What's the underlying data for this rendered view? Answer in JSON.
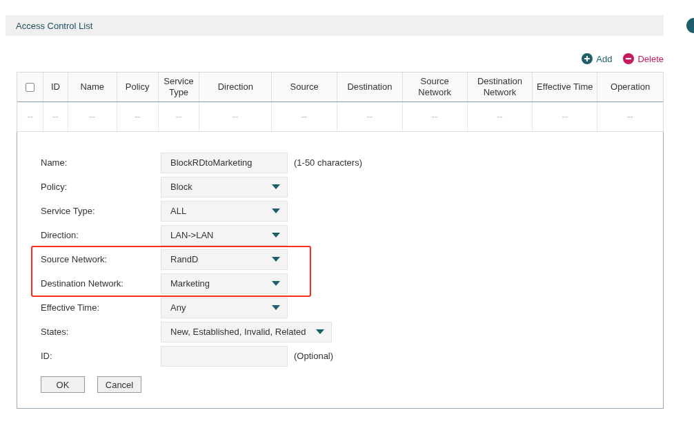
{
  "panel_title": "Access Control List",
  "toolbar": {
    "add": "Add",
    "delete": "Delete"
  },
  "table": {
    "columns": [
      {
        "kind": "checkbox",
        "checked": false
      },
      {
        "kind": "text",
        "label": "ID"
      },
      {
        "kind": "text",
        "label": "Name"
      },
      {
        "kind": "text",
        "label": "Policy"
      },
      {
        "kind": "text",
        "label": "Service Type"
      },
      {
        "kind": "text",
        "label": "Direction"
      },
      {
        "kind": "text",
        "label": "Source"
      },
      {
        "kind": "text",
        "label": "Destination"
      },
      {
        "kind": "text",
        "label": "Source Network"
      },
      {
        "kind": "text",
        "label": "Destination Network"
      },
      {
        "kind": "text",
        "label": "Effective Time"
      },
      {
        "kind": "text",
        "label": "Operation"
      }
    ],
    "rows": [
      {
        "cells": [
          "--",
          "--",
          "--",
          "--",
          "--",
          "--",
          "--",
          "--",
          "--",
          "--",
          "--",
          "--"
        ]
      }
    ]
  },
  "form": {
    "fields": [
      {
        "kind": "text",
        "label": "Name:",
        "value": "BlockRDtoMarketing",
        "note": "(1-50 characters)",
        "highlighted": false
      },
      {
        "kind": "select",
        "label": "Policy:",
        "value": "Block",
        "highlighted": false
      },
      {
        "kind": "select",
        "label": "Service Type:",
        "value": "ALL",
        "highlighted": false
      },
      {
        "kind": "select",
        "label": "Direction:",
        "value": "LAN->LAN",
        "highlighted": false
      },
      {
        "kind": "select",
        "label": "Source Network:",
        "value": "RandD",
        "highlighted": true
      },
      {
        "kind": "select",
        "label": "Destination Network:",
        "value": "Marketing",
        "highlighted": true
      },
      {
        "kind": "select",
        "label": "Effective Time:",
        "value": "Any",
        "highlighted": false
      },
      {
        "kind": "select",
        "label": "States:",
        "value": "New, Established, Invalid, Related",
        "highlighted": false
      },
      {
        "kind": "text",
        "label": "ID:",
        "note": "(Optional)",
        "highlighted": false
      }
    ],
    "buttons": [
      "OK",
      "Cancel"
    ]
  }
}
